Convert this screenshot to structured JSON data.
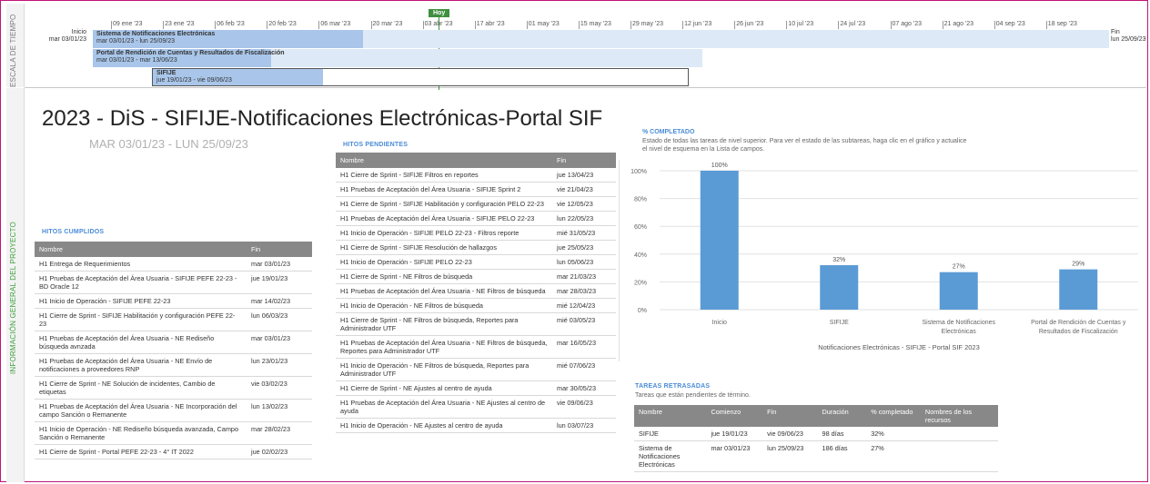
{
  "timeline": {
    "strip_label": "ESCALA DE TIEMPO",
    "today_label": "Hoy",
    "start_label": "Inicio",
    "start_date": "mar 03/01/23",
    "end_label": "Fin",
    "end_date": "lun 25/09/23",
    "ticks": [
      "09 ene '23",
      "23 ene '23",
      "06 feb '23",
      "20 feb '23",
      "06 mar '23",
      "20 mar '23",
      "03 abr '23",
      "17 abr '23",
      "01 may '23",
      "15 may '23",
      "29 may '23",
      "12 jun '23",
      "26 jun '23",
      "10 jul '23",
      "24 jul '23",
      "07 ago '23",
      "21 ago '23",
      "04 sep '23",
      "18 sep '23"
    ],
    "bars": [
      {
        "name": "Sistema de Notificaciones Electrónicas",
        "dates": "mar 03/01/23 - lun 25/09/23"
      },
      {
        "name": "Portal de Rendición de Cuentas y Resultados de Fiscalización",
        "dates": "mar 03/01/23 - mar 13/06/23"
      },
      {
        "name": "SIFIJE",
        "dates": "jue 19/01/23 - vie 09/06/23"
      }
    ]
  },
  "overview": {
    "strip_label": "INFORMACIÓN GENERAL DEL PROYECTO",
    "title": "2023 - DiS - SIFIJE-Notificaciones Electrónicas-Portal SIF",
    "dates": "MAR 03/01/23 - LUN 25/09/23"
  },
  "hitos_cumplidos": {
    "label": "HITOS CUMPLIDOS",
    "headers": [
      "Nombre",
      "Fin"
    ],
    "rows": [
      [
        "H1 Entrega de Requerimientos",
        "mar 03/01/23"
      ],
      [
        "H1 Pruebas de Aceptación del Área Usuaria - SIFIJE PEFE 22-23 - BD Oracle 12",
        "jue 19/01/23"
      ],
      [
        "H1 Inicio de Operación - SIFIJE PEFE 22-23",
        "mar 14/02/23"
      ],
      [
        "H1 Cierre de Sprint - SIFIJE Habilitación y configuración PEFE 22-23",
        "lun 06/03/23"
      ],
      [
        "H1 Pruebas de Aceptación del Área Usuaria - NE Rediseño búsqueda avnzada",
        "mar 03/01/23"
      ],
      [
        "H1 Pruebas de Aceptación del Área Usuaria - NE Envío de notificaciones a proveedores RNP",
        "lun 23/01/23"
      ],
      [
        "H1 Cierre de Sprint - NE Solución de incidentes, Cambio de etiquetas",
        "vie 03/02/23"
      ],
      [
        "H1 Pruebas de Aceptación del Área Usuaria - NE Incorporación del campo Sanción o Remanente",
        "lun 13/02/23"
      ],
      [
        "H1 Inicio de Operación - NE Rediseño búsqueda avanzada, Campo Sanción o Remanente",
        "mar 28/02/23"
      ],
      [
        "H1 Cierre de Sprint - Portal PEFE 22-23 - 4° IT 2022",
        "jue 02/02/23"
      ]
    ]
  },
  "hitos_pendientes": {
    "label": "HITOS PENDIENTES",
    "headers": [
      "Nombre",
      "Fin"
    ],
    "rows": [
      [
        "H1 Cierre de Sprint - SIFIJE Filtros en reportes",
        "jue 13/04/23"
      ],
      [
        "H1 Pruebas de Aceptación del Área Usuaria - SIFIJE Sprint 2",
        "vie 21/04/23"
      ],
      [
        "H1 Cierre de Sprint - SIFIJE Habilitación y configuración PELO 22-23",
        "vie 12/05/23"
      ],
      [
        "H1 Pruebas de Aceptación del Área Usuaria - SIFIJE PELO 22-23",
        "lun 22/05/23"
      ],
      [
        "H1 Inicio de Operación - SIFIJE PELO 22-23 - Filtros reporte",
        "mié 31/05/23"
      ],
      [
        "H1 Cierre de Sprint - SIFIJE Resolución de hallazgos",
        "jue 25/05/23"
      ],
      [
        "H1 Inicio de Operación - SIFIJE PELO 22-23",
        "lun 05/06/23"
      ],
      [
        "H1 Cierre de Sprint - NE Filtros de búsqueda",
        "mar 21/03/23"
      ],
      [
        "H1 Pruebas de Aceptación del Área Usuaria - NE Filtros de búsqueda",
        "mar 28/03/23"
      ],
      [
        "H1 Inicio de Operación - NE Filtros de búsqueda",
        "mié 12/04/23"
      ],
      [
        "H1 Cierre de Sprint - NE Filtros de búsqueda, Reportes para Administrador UTF",
        "mié 03/05/23"
      ],
      [
        "H1 Pruebas de Aceptación del Área Usuaria - NE Filtros de búsqueda, Reportes para Administrador UTF",
        "mar 16/05/23"
      ],
      [
        "H1 Inicio de Operación - NE Filtros de búsqueda, Reportes para Administrador UTF",
        "mié 07/06/23"
      ],
      [
        "H1 Cierre de Sprint - NE Ajustes al centro de ayuda",
        "mar 30/05/23"
      ],
      [
        "H1 Pruebas de Aceptación del Área Usuaria - NE Ajustes al centro de ayuda",
        "vie 09/06/23"
      ],
      [
        "H1 Inicio de Operación - NE Ajustes al centro de ayuda",
        "lun 03/07/23"
      ]
    ]
  },
  "completado": {
    "label": "% COMPLETADO",
    "desc": "Estado de todas las tareas de nivel superior. Para ver el estado de las subtareas, haga clic en el gráfico y actualice el nivel de esquema en la Lista de campos."
  },
  "chart_data": {
    "type": "bar",
    "categories": [
      "Inicio",
      "SIFIJE",
      "Sistema de Notificaciones Electrónicas",
      "Portal de Rendición de Cuentas y Resultados de Fiscalización"
    ],
    "values": [
      100,
      32,
      27,
      29
    ],
    "value_labels": [
      "100%",
      "32%",
      "27%",
      "29%"
    ],
    "yticks": [
      "0%",
      "20%",
      "40%",
      "60%",
      "80%",
      "100%"
    ],
    "ylim": [
      0,
      100
    ],
    "xlabel": "Notificaciones Electrónicas - SIFIJE - Portal SIF 2023",
    "bar_color": "#5b9bd5",
    "grid": true
  },
  "tareas_retrasadas": {
    "label": "TAREAS RETRASADAS",
    "desc": "Tareas que están pendientes de término.",
    "headers": [
      "Nombre",
      "Comienzo",
      "Fin",
      "Duración",
      "% completado",
      "Nombres de los recursos"
    ],
    "rows": [
      [
        "SIFIJE",
        "jue 19/01/23",
        "vie 09/06/23",
        "98 días",
        "32%",
        ""
      ],
      [
        "Sistema de Notificaciones Electrónicas",
        "mar 03/01/23",
        "lun 25/09/23",
        "186 días",
        "27%",
        ""
      ]
    ]
  }
}
